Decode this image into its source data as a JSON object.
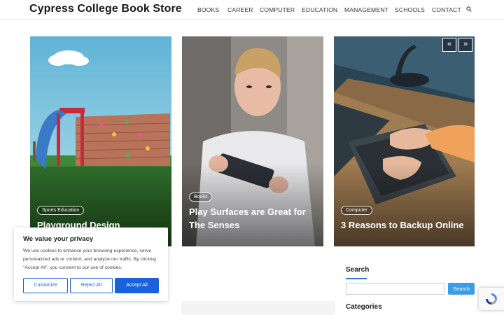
{
  "header": {
    "site_title": "Cypress College Book Store",
    "nav": [
      "BOOKS",
      "CAREER",
      "COMPUTER",
      "EDUCATION",
      "MANAGEMENT",
      "SCHOOLS",
      "CONTACT"
    ],
    "search_icon": "search-icon"
  },
  "slider": {
    "prev_label": "«",
    "next_label": "»",
    "cards": [
      {
        "category": "Sports Education",
        "title": "Playground Design"
      },
      {
        "category": "Books",
        "title": "Play Surfaces are Great for The Senses"
      },
      {
        "category": "Computer",
        "title": "3 Reasons to Backup Online"
      }
    ]
  },
  "sidebar": {
    "search_heading": "Search",
    "search_button": "Search",
    "search_placeholder": "",
    "categories_heading": "Categories"
  },
  "cookie_banner": {
    "title": "We value your privacy",
    "text": "We use cookies to enhance your browsing experience, serve personalized ads or content, and analyze our traffic. By clicking \"Accept All\", you consent to our use of cookies.",
    "customize_label": "Customize",
    "reject_label": "Reject All",
    "accept_label": "Accept All"
  },
  "colors": {
    "accent_blue": "#1863dc",
    "search_button": "#3a9ee6"
  }
}
